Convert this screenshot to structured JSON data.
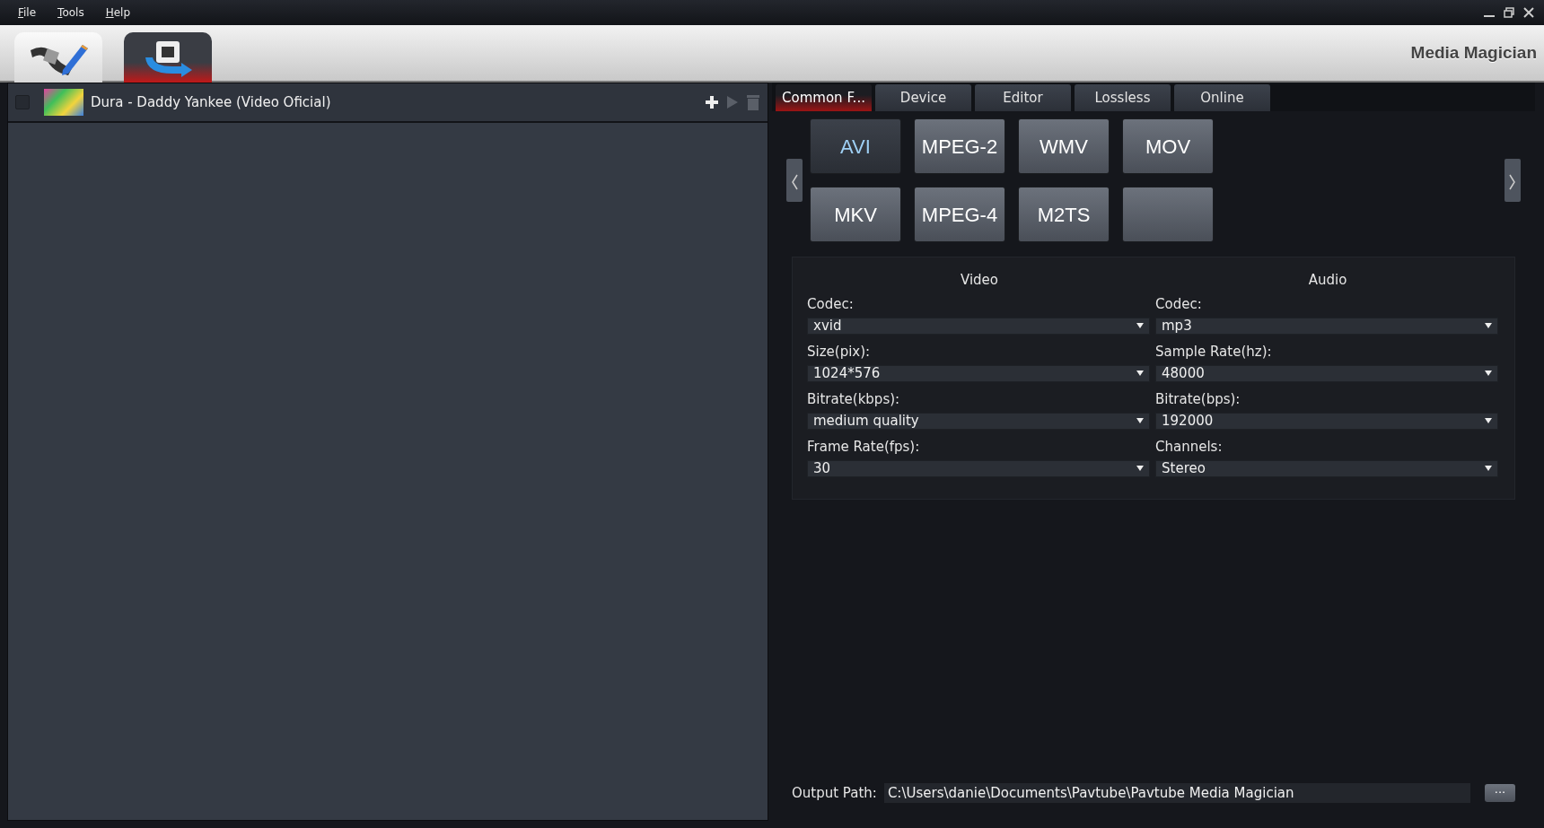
{
  "menu": [
    {
      "label": "File"
    },
    {
      "label": "Tools"
    },
    {
      "label": "Help"
    }
  ],
  "app_title": "Media Magician",
  "mode_tabs": [
    {
      "kind": "editor",
      "selected": false
    },
    {
      "kind": "converter",
      "selected": true
    }
  ],
  "files": [
    {
      "title": "Dura - Daddy Yankee (Video Oficial)",
      "checked": false
    }
  ],
  "format_tabs": [
    {
      "label": "Common F...",
      "selected": true
    },
    {
      "label": "Device",
      "selected": false
    },
    {
      "label": "Editor",
      "selected": false
    },
    {
      "label": "Lossless",
      "selected": false
    },
    {
      "label": "Online",
      "selected": false
    }
  ],
  "formats": [
    {
      "label": "AVI",
      "selected": true
    },
    {
      "label": "MPEG-2",
      "selected": false
    },
    {
      "label": "WMV",
      "selected": false
    },
    {
      "label": "MOV",
      "selected": false
    },
    {
      "label": "MKV",
      "selected": false
    },
    {
      "label": "MPEG-4",
      "selected": false
    },
    {
      "label": "M2TS",
      "selected": false
    },
    {
      "selected": false
    }
  ],
  "settings": {
    "video": {
      "heading": "Video",
      "fields": [
        {
          "label": "Codec:",
          "value": "xvid"
        },
        {
          "label": "Size(pix):",
          "value": "1024*576"
        },
        {
          "label": "Bitrate(kbps):",
          "value": "medium quality"
        },
        {
          "label": "Frame Rate(fps):",
          "value": "30"
        }
      ]
    },
    "audio": {
      "heading": "Audio",
      "fields": [
        {
          "label": "Codec:",
          "value": "mp3"
        },
        {
          "label": "Sample Rate(hz):",
          "value": "48000"
        },
        {
          "label": "Bitrate(bps):",
          "value": "192000"
        },
        {
          "label": "Channels:",
          "value": "Stereo"
        }
      ]
    }
  },
  "output": {
    "label": "Output Path:",
    "value": "C:\\Users\\danie\\Documents\\Pavtube\\Pavtube Media Magician",
    "browse": "···"
  }
}
